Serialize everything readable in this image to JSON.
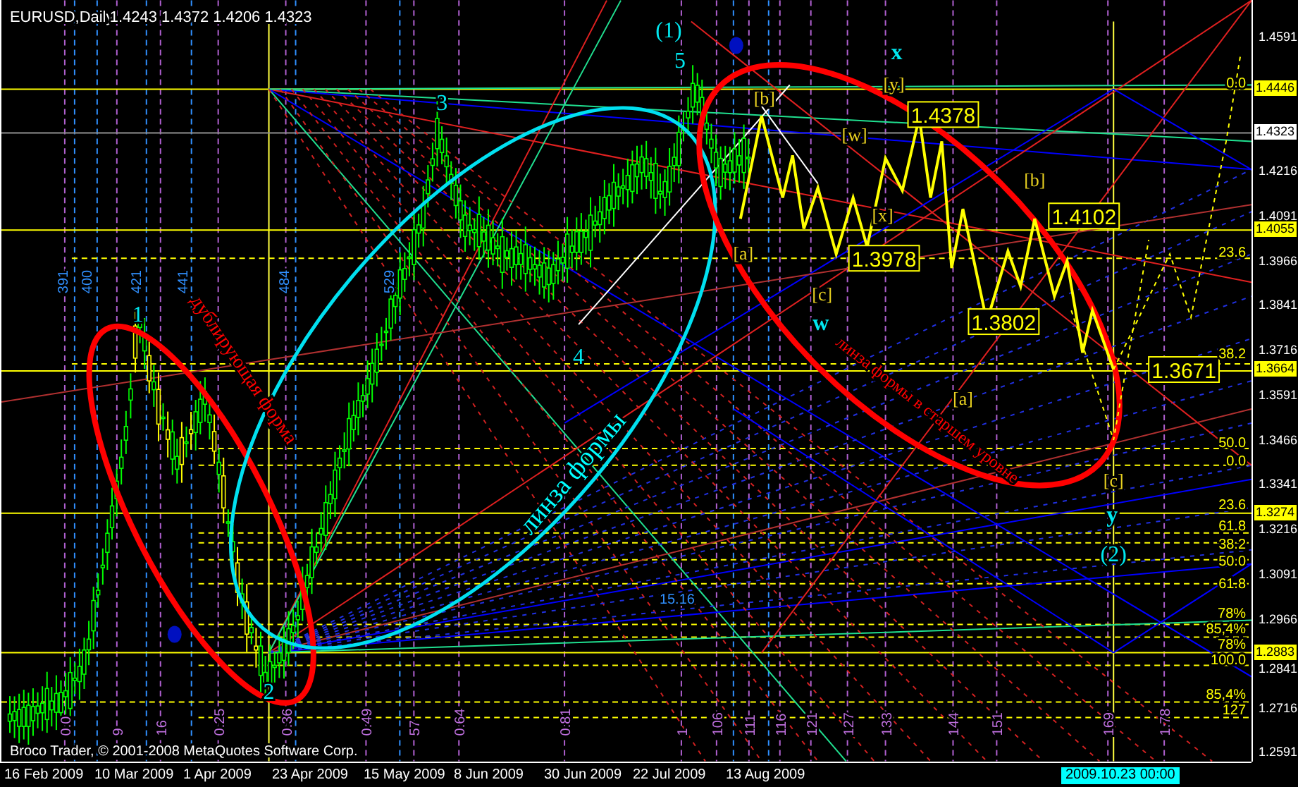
{
  "chart": {
    "symbol": "EURUSD,Daily",
    "ohlc": "1.4243 1.4372 1.4206 1.4323",
    "copyright": "Broco Trader, © 2001-2008 MetaQuotes Software Corp."
  },
  "price_axis": {
    "labels": [
      "1.4591",
      "1.4216",
      "1.4091",
      "1.3966",
      "1.3841",
      "1.3716",
      "1.3591",
      "1.3466",
      "1.3341",
      "1.3216",
      "1.3091",
      "1.2966",
      "1.2841",
      "1.2716",
      "1.2591"
    ],
    "tags": [
      {
        "text": "1.4446",
        "color": "#ffff00"
      },
      {
        "text": "1.4323",
        "color": "#ffffff"
      },
      {
        "text": "1.4055",
        "color": "#ffff00"
      },
      {
        "text": "1.3664",
        "color": "#ffff00"
      },
      {
        "text": "1.3274",
        "color": "#ffff00"
      },
      {
        "text": "1.2883",
        "color": "#ffff00"
      }
    ]
  },
  "time_axis": {
    "labels": [
      "16 Feb 2009",
      "10 Mar 2009",
      "1 Apr 2009",
      "23 Apr 2009",
      "15 May 2009",
      "8 Jun 2009",
      "30 Jun 2009",
      "22 Jul 2009",
      "13 Aug 2009"
    ],
    "cursor": "2009.10.23 00:00"
  },
  "wave_labels": [
    "1",
    "2",
    "3",
    "4",
    "5",
    "(1)",
    "x",
    "w",
    "y",
    "(2)"
  ],
  "bracket_labels": [
    "[b]",
    "[y]",
    "[w]",
    "[x]",
    "[a]",
    "[c]",
    "[b]",
    "[a]",
    "[c]"
  ],
  "price_boxes": [
    "1.4378",
    "1.3978",
    "1.4102",
    "1.3802",
    "1.3671"
  ],
  "fib_labels": [
    "0.0",
    "23.6",
    "38.2",
    "50.0",
    "0.0",
    "23.6",
    "61.8",
    "38.2",
    "50.0",
    "61.8",
    "78%",
    "85,4%",
    "78%",
    "100.0",
    "85,4%",
    "127"
  ],
  "cycle_counts": [
    "391",
    "400",
    "421",
    "441",
    "484",
    "529",
    "15.16"
  ],
  "time_ratios": [
    "0.0",
    "9",
    "16",
    "0.25",
    "0.36",
    "0.49",
    "57",
    "0.64",
    "0.81",
    "1",
    "106",
    "111",
    "116",
    "121",
    "127",
    "133",
    "144",
    "151",
    "169",
    "1.78"
  ],
  "annotations": [
    {
      "text": "дублирующая форма",
      "color": "#ff0000"
    },
    {
      "text": "линза формы",
      "color": "#00ffff"
    },
    {
      "text": "линза формы в старшем уровне",
      "color": "#ff0000"
    }
  ]
}
